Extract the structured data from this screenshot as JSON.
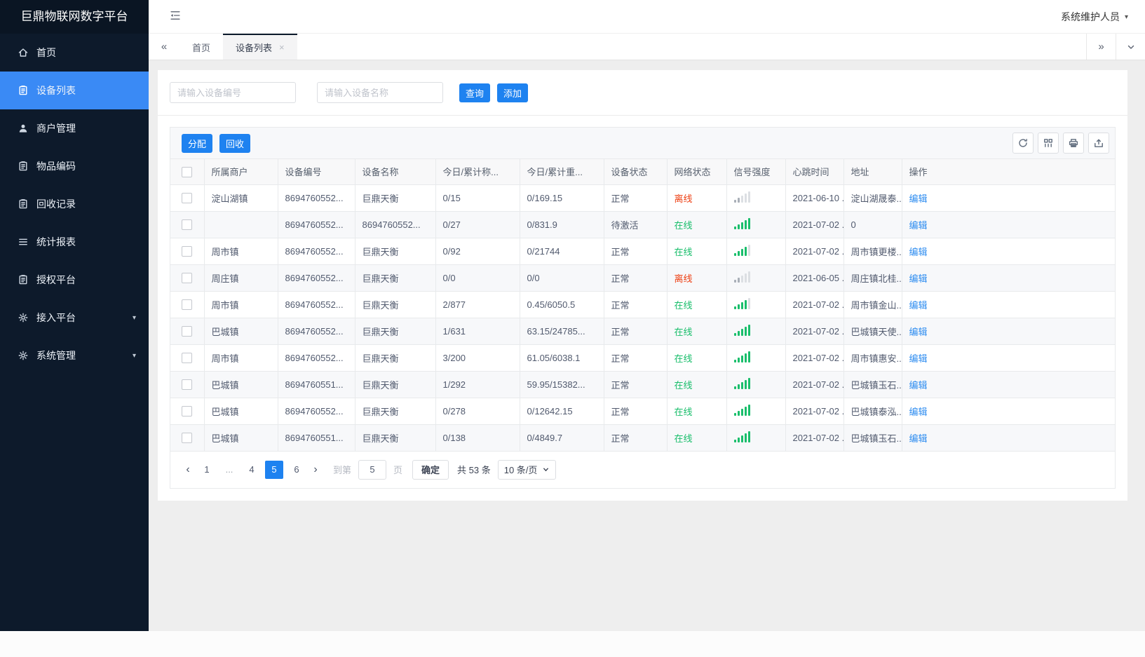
{
  "app": {
    "title": "巨鼎物联网数字平台",
    "user_role": "系统维护人员"
  },
  "colors": {
    "primary": "#1e82f0",
    "online_green": "#19be6b",
    "offline_red": "#ed4014",
    "link_blue": "#2d8cf0",
    "sidebar_active": "#3a8af5"
  },
  "header": {
    "collapse_icon": "menu-fold-icon",
    "user_caret_icon": "caret-down-icon"
  },
  "sidebar": {
    "items": [
      {
        "key": "home",
        "label": "首页",
        "icon": "home-icon",
        "active": false,
        "caret": false
      },
      {
        "key": "device-list",
        "label": "设备列表",
        "icon": "clipboard-icon",
        "active": true,
        "caret": false
      },
      {
        "key": "merchant-management",
        "label": "商户管理",
        "icon": "user-icon",
        "active": false,
        "caret": false
      },
      {
        "key": "item-code",
        "label": "物品编码",
        "icon": "clipboard-icon",
        "active": false,
        "caret": false
      },
      {
        "key": "recycle-record",
        "label": "回收记录",
        "icon": "clipboard-icon",
        "active": false,
        "caret": false
      },
      {
        "key": "statistics-report",
        "label": "统计报表",
        "icon": "list-icon",
        "active": false,
        "caret": false
      },
      {
        "key": "authorization-platform",
        "label": "授权平台",
        "icon": "clipboard-icon",
        "active": false,
        "caret": false
      },
      {
        "key": "access-platform",
        "label": "接入平台",
        "icon": "gear-icon",
        "active": false,
        "caret": true
      },
      {
        "key": "system-management",
        "label": "系统管理",
        "icon": "gear-icon",
        "active": false,
        "caret": true
      }
    ]
  },
  "tabbar": {
    "collapse_left_icon": "chevrons-left-icon",
    "overflow_right_icon": "chevrons-right-icon",
    "dropdown_icon": "chevron-down-icon",
    "close_icon": "close-icon",
    "tabs": [
      {
        "key": "home",
        "label": "首页",
        "active": false,
        "closable": false
      },
      {
        "key": "device-list",
        "label": "设备列表",
        "active": true,
        "closable": true
      }
    ]
  },
  "filters": {
    "device_code_placeholder": "请输入设备编号",
    "device_name_placeholder": "请输入设备名称",
    "query_label": "查询",
    "add_label": "添加"
  },
  "grid_toolbar": {
    "assign_label": "分配",
    "recycle_label": "回收",
    "icon_buttons": [
      {
        "key": "refresh",
        "icon": "refresh-icon"
      },
      {
        "key": "columns",
        "icon": "columns-icon"
      },
      {
        "key": "print",
        "icon": "printer-icon"
      },
      {
        "key": "export",
        "icon": "export-icon"
      }
    ]
  },
  "table": {
    "columns": [
      "所属商户",
      "设备编号",
      "设备名称",
      "今日/累计称...",
      "今日/累计重...",
      "设备状态",
      "网络状态",
      "信号强度",
      "心跳时间",
      "地址",
      "操作"
    ],
    "edit_label": "编辑",
    "signal_icon": "signal-bars-icon",
    "rows": [
      {
        "merchant": "淀山湖镇",
        "code": "8694760552...",
        "name": "巨鼎天衡",
        "count": "0/15",
        "weight": "0/169.15",
        "status": "正常",
        "network": "离线",
        "online": false,
        "signal": 2,
        "heartbeat": "2021-06-10 ...",
        "address": "淀山湖晟泰..."
      },
      {
        "merchant": "",
        "code": "8694760552...",
        "name": "8694760552...",
        "count": "0/27",
        "weight": "0/831.9",
        "status": "待激活",
        "network": "在线",
        "online": true,
        "signal": 5,
        "heartbeat": "2021-07-02 ...",
        "address": "0"
      },
      {
        "merchant": "周市镇",
        "code": "8694760552...",
        "name": "巨鼎天衡",
        "count": "0/92",
        "weight": "0/21744",
        "status": "正常",
        "network": "在线",
        "online": true,
        "signal": 4,
        "heartbeat": "2021-07-02 ...",
        "address": "周市镇更楼..."
      },
      {
        "merchant": "周庄镇",
        "code": "8694760552...",
        "name": "巨鼎天衡",
        "count": "0/0",
        "weight": "0/0",
        "status": "正常",
        "network": "离线",
        "online": false,
        "signal": 2,
        "heartbeat": "2021-06-05 ...",
        "address": "周庄镇北桂..."
      },
      {
        "merchant": "周市镇",
        "code": "8694760552...",
        "name": "巨鼎天衡",
        "count": "2/877",
        "weight": "0.45/6050.5",
        "status": "正常",
        "network": "在线",
        "online": true,
        "signal": 4,
        "heartbeat": "2021-07-02 ...",
        "address": "周市镇金山..."
      },
      {
        "merchant": "巴城镇",
        "code": "8694760552...",
        "name": "巨鼎天衡",
        "count": "1/631",
        "weight": "63.15/24785...",
        "status": "正常",
        "network": "在线",
        "online": true,
        "signal": 5,
        "heartbeat": "2021-07-02 ...",
        "address": "巴城镇天使..."
      },
      {
        "merchant": "周市镇",
        "code": "8694760552...",
        "name": "巨鼎天衡",
        "count": "3/200",
        "weight": "61.05/6038.1",
        "status": "正常",
        "network": "在线",
        "online": true,
        "signal": 5,
        "heartbeat": "2021-07-02 ...",
        "address": "周市镇惠安..."
      },
      {
        "merchant": "巴城镇",
        "code": "8694760551...",
        "name": "巨鼎天衡",
        "count": "1/292",
        "weight": "59.95/15382...",
        "status": "正常",
        "network": "在线",
        "online": true,
        "signal": 5,
        "heartbeat": "2021-07-02 ...",
        "address": "巴城镇玉石..."
      },
      {
        "merchant": "巴城镇",
        "code": "8694760552...",
        "name": "巨鼎天衡",
        "count": "0/278",
        "weight": "0/12642.15",
        "status": "正常",
        "network": "在线",
        "online": true,
        "signal": 5,
        "heartbeat": "2021-07-02 ...",
        "address": "巴城镇泰泓..."
      },
      {
        "merchant": "巴城镇",
        "code": "8694760551...",
        "name": "巨鼎天衡",
        "count": "0/138",
        "weight": "0/4849.7",
        "status": "正常",
        "network": "在线",
        "online": true,
        "signal": 5,
        "heartbeat": "2021-07-02 ...",
        "address": "巴城镇玉石..."
      }
    ]
  },
  "pagination": {
    "prev_icon": "chevron-left-icon",
    "next_icon": "chevron-right-icon",
    "pages": [
      "1",
      "...",
      "4",
      "5",
      "6"
    ],
    "active_page": "5",
    "jump_prefix": "到第",
    "jump_value": "5",
    "jump_suffix": "页",
    "confirm_label": "确定",
    "total_label": "共 53 条",
    "page_size_label": "10 条/页"
  }
}
